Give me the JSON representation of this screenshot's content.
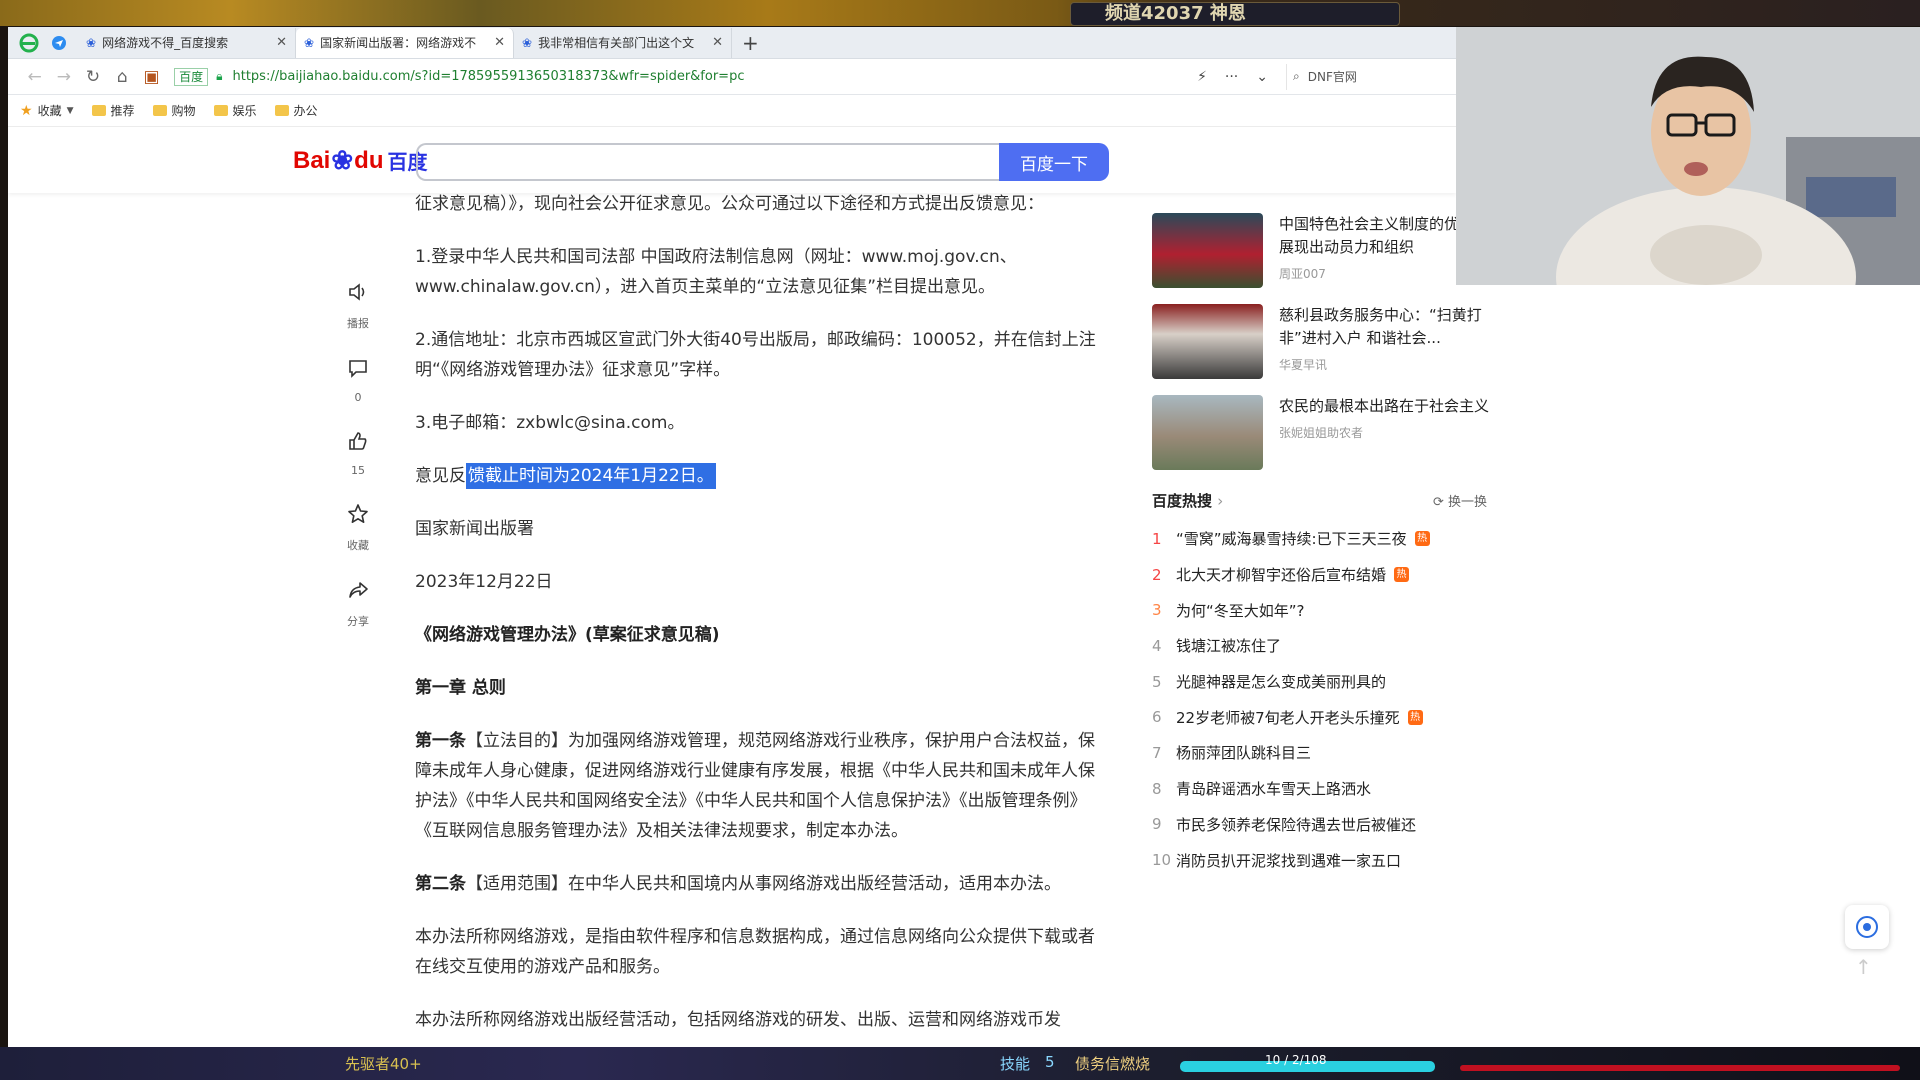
{
  "game_overlay": {
    "top_bar_text": "频道42037 神恩",
    "bottom_skill_text": "先驱者40+",
    "bottom_label": "技能",
    "bottom_number": "5",
    "bottom_status": "债务信燃烧",
    "bottom_counter": "10 / 2/108"
  },
  "tabs": [
    {
      "label": "网络游戏不得_百度搜索",
      "active": false
    },
    {
      "label": "国家新闻出版署：网络游戏不",
      "active": true
    },
    {
      "label": "我非常相信有关部门出这个文",
      "active": false
    }
  ],
  "address": {
    "site_tag": "百度",
    "url": "https://baijiahao.baidu.com/s?id=1785955913650318373&wfr=spider&for=pc",
    "search_placeholder": "DNF官网"
  },
  "bookmarks": [
    {
      "label": "收藏",
      "icon": "star-icon"
    },
    {
      "label": "推荐",
      "icon": "folder-icon"
    },
    {
      "label": "购物",
      "icon": "folder-icon"
    },
    {
      "label": "娱乐",
      "icon": "folder-icon"
    },
    {
      "label": "办公",
      "icon": "folder-icon"
    }
  ],
  "baidu": {
    "logo_bai": "Bai",
    "logo_du": "du",
    "logo_cn": "百度",
    "search_button": "百度一下"
  },
  "side_actions": [
    {
      "name": "broadcast",
      "label": "播报",
      "icon": "speaker-icon"
    },
    {
      "name": "comment",
      "label": "0",
      "icon": "comment-icon"
    },
    {
      "name": "like",
      "label": "15",
      "icon": "thumbs-up-icon"
    },
    {
      "name": "favorite",
      "label": "收藏",
      "icon": "star-outline-icon"
    },
    {
      "name": "share",
      "label": "分享",
      "icon": "share-icon"
    }
  ],
  "article": {
    "p0": "征求意见稿）》，现向社会公开征求意见。公众可通过以下途径和方式提出反馈意见：",
    "p1": "1.登录中华人民共和国司法部 中国政府法制信息网（网址：www.moj.gov.cn、www.chinalaw.gov.cn），进入首页主菜单的“立法意见征集”栏目提出意见。",
    "p2": "2.通信地址：北京市西城区宣武门外大街40号出版局，邮政编码：100052，并在信封上注明“《网络游戏管理办法》征求意见”字样。",
    "p3": "3.电子邮箱：zxbwlc@sina.com。",
    "p4_pre": "意见反",
    "p4_hl": "馈截止时间为2024年1月22日。",
    "p5": "国家新闻出版署",
    "p6": "2023年12月22日",
    "p7": "《网络游戏管理办法》(草案征求意见稿)",
    "p8": "第一章 总则",
    "p9_bold": "第一条",
    "p9": "【立法目的】为加强网络游戏管理，规范网络游戏行业秩序，保护用户合法权益，保障未成年人身心健康，促进网络游戏行业健康有序发展，根据《中华人民共和国未成年人保护法》《中华人民共和国网络安全法》《中华人民共和国个人信息保护法》《出版管理条例》《互联网信息服务管理办法》及相关法律法规要求，制定本办法。",
    "p10_bold": "第二条",
    "p10": "【适用范围】在中华人民共和国境内从事网络游戏出版经营活动，适用本办法。",
    "p11": "本办法所称网络游戏，是指由软件程序和信息数据构成，通过信息网络向公众提供下载或者在线交互使用的游戏产品和服务。",
    "p12": "本办法所称网络游戏出版经营活动，包括网络游戏的研发、出版、运营和网络游戏币发"
  },
  "news": [
    {
      "title": "中国特色社会主义制度的优势，展现出动员力和组织",
      "source": "周亚007"
    },
    {
      "title": "慈利县政务服务中心：“扫黄打非”进村入户 和谐社会...",
      "source": "华夏早讯"
    },
    {
      "title": "农民的最根本出路在于社会主义",
      "source": "张妮姐姐助农者"
    }
  ],
  "hot": {
    "title": "百度热搜",
    "refresh_label": "换一换",
    "items": [
      {
        "rank": "1",
        "text": "“雪窝”威海暴雪持续:已下三天三夜",
        "badge": "热"
      },
      {
        "rank": "2",
        "text": "北大天才柳智宇还俗后宣布结婚",
        "badge": "热"
      },
      {
        "rank": "3",
        "text": "为何“冬至大如年”?",
        "badge": ""
      },
      {
        "rank": "4",
        "text": "钱塘江被冻住了",
        "badge": ""
      },
      {
        "rank": "5",
        "text": "光腿神器是怎么变成美丽刑具的",
        "badge": ""
      },
      {
        "rank": "6",
        "text": "22岁老师被7旬老人开老头乐撞死",
        "badge": "热"
      },
      {
        "rank": "7",
        "text": "杨丽萍团队跳科目三",
        "badge": ""
      },
      {
        "rank": "8",
        "text": "青岛辟谣洒水车雪天上路洒水",
        "badge": ""
      },
      {
        "rank": "9",
        "text": "市民多领养老保险待遇去世后被催还",
        "badge": ""
      },
      {
        "rank": "10",
        "text": "消防员扒开泥浆找到遇难一家五口",
        "badge": ""
      }
    ]
  },
  "colors": {
    "baidu_blue": "#4e6ef2",
    "highlight": "#2f6fe4",
    "hot_red": "#f54545",
    "url_green": "#1f7f30"
  }
}
